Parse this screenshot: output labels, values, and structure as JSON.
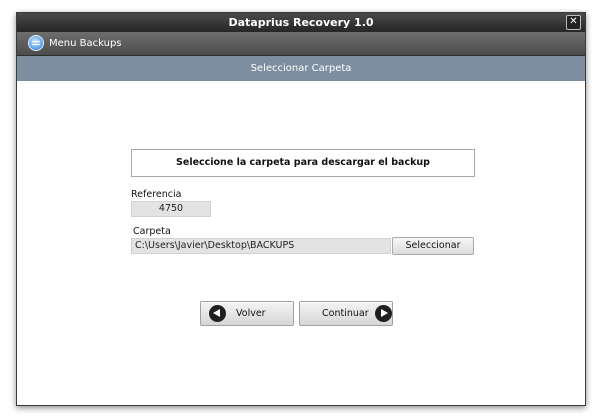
{
  "window": {
    "title": "Dataprius Recovery 1.0",
    "close_glyph": "✕"
  },
  "menu": {
    "backups_label": "Menu Backups",
    "backups_icon": "database-icon"
  },
  "section": {
    "title": "Seleccionar Carpeta"
  },
  "instruction": "Seleccione la carpeta para descargar el backup",
  "referencia": {
    "label": "Referencia",
    "value": "4750"
  },
  "carpeta": {
    "label": "Carpeta",
    "value": "C:\\Users\\Javier\\Desktop\\BACKUPS",
    "select_label": "Seleccionar"
  },
  "nav": {
    "back_label": "Volver",
    "continue_label": "Continuar"
  },
  "colors": {
    "section_header": "#7e8ea1",
    "titlebar": "#2f2f2f",
    "menubar": "#5c5c5c"
  }
}
